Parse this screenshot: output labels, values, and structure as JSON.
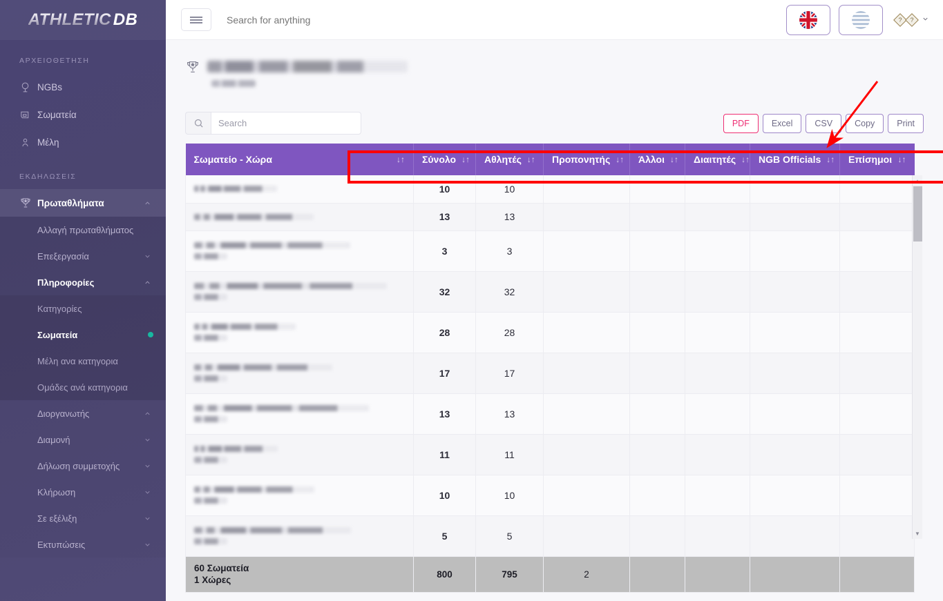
{
  "brand": {
    "part1": "ATHLETIC",
    "part2": "DB"
  },
  "sidebar": {
    "sections": [
      {
        "label": "ΑΡΧΕΙΟΘΕΤΗΣΗ"
      },
      {
        "label": "ΕΚΔΗΛΩΣΕΙΣ"
      }
    ],
    "archive_items": [
      {
        "label": "NGBs",
        "icon": "globe-icon"
      },
      {
        "label": "Σωματεία",
        "icon": "club-icon"
      },
      {
        "label": "Μέλη",
        "icon": "member-icon"
      }
    ],
    "events_items": [
      {
        "label": "Πρωταθλήματα",
        "icon": "trophy-icon",
        "chevron": "up",
        "active": true
      }
    ],
    "championship_sub": [
      {
        "label": "Αλλαγή πρωταθλήματος",
        "chevron": ""
      },
      {
        "label": "Επεξεργασία",
        "chevron": "down"
      },
      {
        "label": "Πληροφορίες",
        "chevron": "up",
        "active": true
      }
    ],
    "info_sub": [
      {
        "label": "Κατηγορίες",
        "active": false,
        "dot": false
      },
      {
        "label": "Σωματεία",
        "active": true,
        "dot": true
      },
      {
        "label": "Μέλη ανα κατηγορια",
        "active": false,
        "dot": false
      },
      {
        "label": "Ομάδες ανά κατηγορια",
        "active": false,
        "dot": false
      }
    ],
    "tail_items": [
      {
        "label": "Διοργανωτής",
        "chevron": "up"
      },
      {
        "label": "Διαμονή",
        "chevron": "down"
      },
      {
        "label": "Δήλωση συμμετοχής",
        "chevron": "down"
      },
      {
        "label": "Κλήρωση",
        "chevron": "down"
      },
      {
        "label": "Σε εξέλιξη",
        "chevron": "down"
      },
      {
        "label": "Εκτυπώσεις",
        "chevron": "down"
      }
    ]
  },
  "topbar": {
    "search_placeholder": "Search for anything",
    "lang_en": "en-flag-icon",
    "lang_gr": "gr-flag-icon",
    "user_caret": "chevron-down-icon"
  },
  "page": {
    "title_redacted": "",
    "subtitle_redacted": ""
  },
  "toolbar": {
    "search_placeholder": "Search",
    "search_value": "",
    "buttons": [
      {
        "label": "PDF",
        "accent": true
      },
      {
        "label": "Excel",
        "accent": false
      },
      {
        "label": "CSV",
        "accent": false
      },
      {
        "label": "Copy",
        "accent": false
      },
      {
        "label": "Print",
        "accent": false
      }
    ]
  },
  "table": {
    "columns": [
      {
        "label": "Σωματείο - Χώρα",
        "sort": "↓↑"
      },
      {
        "label": "Σύνολο",
        "sort": "↓↑"
      },
      {
        "label": "Αθλητές",
        "sort": "↓↑"
      },
      {
        "label": "Προπονητής",
        "sort": "↓↑"
      },
      {
        "label": "Άλλοι",
        "sort": "↓↑"
      },
      {
        "label": "Διαιτητές",
        "sort": "↓↑"
      },
      {
        "label": "NGB Officials",
        "sort": "↓↑"
      },
      {
        "label": "Επίσημοι",
        "sort": "↓↑"
      }
    ],
    "rows": [
      {
        "club": "",
        "country": "",
        "two_line": false,
        "total": "10",
        "athletes": "10",
        "coach": "",
        "others": "",
        "referees": "",
        "ngb": "",
        "officials": ""
      },
      {
        "club": "",
        "country": "",
        "two_line": false,
        "total": "13",
        "athletes": "13",
        "coach": "",
        "others": "",
        "referees": "",
        "ngb": "",
        "officials": ""
      },
      {
        "club": "",
        "country": "",
        "two_line": true,
        "total": "3",
        "athletes": "3",
        "coach": "",
        "others": "",
        "referees": "",
        "ngb": "",
        "officials": ""
      },
      {
        "club": "",
        "country": "",
        "two_line": true,
        "total": "32",
        "athletes": "32",
        "coach": "",
        "others": "",
        "referees": "",
        "ngb": "",
        "officials": ""
      },
      {
        "club": "",
        "country": "",
        "two_line": true,
        "total": "28",
        "athletes": "28",
        "coach": "",
        "others": "",
        "referees": "",
        "ngb": "",
        "officials": ""
      },
      {
        "club": "",
        "country": "",
        "two_line": true,
        "total": "17",
        "athletes": "17",
        "coach": "",
        "others": "",
        "referees": "",
        "ngb": "",
        "officials": ""
      },
      {
        "club": "",
        "country": "",
        "two_line": true,
        "total": "13",
        "athletes": "13",
        "coach": "",
        "others": "",
        "referees": "",
        "ngb": "",
        "officials": ""
      },
      {
        "club": "",
        "country": "",
        "two_line": true,
        "total": "11",
        "athletes": "11",
        "coach": "",
        "others": "",
        "referees": "",
        "ngb": "",
        "officials": ""
      },
      {
        "club": "",
        "country": "",
        "two_line": true,
        "total": "10",
        "athletes": "10",
        "coach": "",
        "others": "",
        "referees": "",
        "ngb": "",
        "officials": ""
      },
      {
        "club": "",
        "country": "",
        "two_line": true,
        "total": "5",
        "athletes": "5",
        "coach": "",
        "others": "",
        "referees": "",
        "ngb": "",
        "officials": ""
      }
    ],
    "footer": {
      "clubs_count": "60 Σωματεία",
      "countries_count": "1 Χώρες",
      "total": "800",
      "athletes": "795",
      "coach": "2",
      "others": "",
      "referees": "",
      "ngb": "",
      "officials": ""
    }
  },
  "colors": {
    "sidebar": "#4a4473",
    "table_header": "#7f56c0",
    "accent_pink": "#ee2d72",
    "annotation_red": "#ff0000",
    "active_dot": "#18b8a0",
    "footer_gray": "#bdbdbd"
  }
}
